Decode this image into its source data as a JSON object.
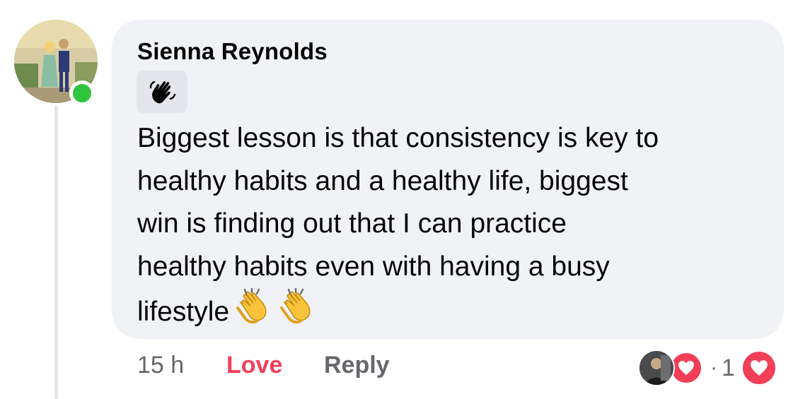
{
  "comment": {
    "author": "Sienna Reynolds",
    "text_lines": [
      "Biggest lesson is that consistency is key to",
      "healthy habits and a healthy life, biggest",
      "win is finding out that I can practice",
      "healthy habits even with having a busy",
      "lifestyle"
    ],
    "badge_icon": "waving-hand-icon",
    "trailing_emoji": [
      "clapping-hands-icon",
      "clapping-hands-icon"
    ],
    "online": true
  },
  "actions": {
    "time": "15 h",
    "love_label": "Love",
    "reply_label": "Reply"
  },
  "reactions": {
    "separator": "·",
    "count": "1",
    "icon": "heart-icon"
  },
  "colors": {
    "bubble": "#f0f2f5",
    "love": "#f33e58",
    "muted": "#65676b",
    "online": "#31c53f"
  }
}
